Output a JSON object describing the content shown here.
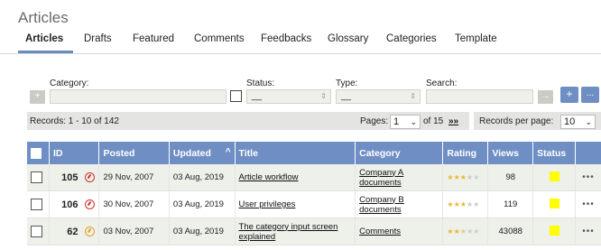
{
  "page": {
    "title": "Articles"
  },
  "tabs": [
    {
      "label": "Articles",
      "active": true
    },
    {
      "label": "Drafts"
    },
    {
      "label": "Featured"
    },
    {
      "label": "Comments"
    },
    {
      "label": "Feedbacks"
    },
    {
      "label": "Glossary"
    },
    {
      "label": "Categories"
    },
    {
      "label": "Template"
    }
  ],
  "filters": {
    "category_label": "Category:",
    "status_label": "Status:",
    "status_value": "__",
    "type_label": "Type:",
    "type_value": "__",
    "search_label": "Search:",
    "add_symbol": "+",
    "go_symbol": "→",
    "add_button": "+",
    "more_button": "..."
  },
  "pager": {
    "records_text": "Records: 1 - 10 of 142",
    "pages_label": "Pages:",
    "current_page": "1",
    "of_text": "of 15",
    "next_symbol": "»»",
    "per_page_label": "Records per page:",
    "per_page_value": "10"
  },
  "table": {
    "headers": {
      "id": "ID",
      "posted": "Posted",
      "updated": "Updated",
      "title": "Title",
      "category": "Category",
      "rating": "Rating",
      "views": "Views",
      "status": "Status"
    },
    "rows": [
      {
        "id": "105",
        "posted": "29 Nov, 2007",
        "updated": "03 Aug, 2019",
        "title_line1": "Article workflow",
        "title_line2": "",
        "category_line1": "Company A",
        "category_line2": "documents",
        "rating": 3,
        "views": "98",
        "icon_color": "#d03030"
      },
      {
        "id": "106",
        "posted": "30 Nov, 2007",
        "updated": "03 Aug, 2019",
        "title_line1": "User privileges",
        "title_line2": "",
        "category_line1": "Company B",
        "category_line2": "documents",
        "rating": 3,
        "views": "119",
        "icon_color": "#d03030"
      },
      {
        "id": "62",
        "posted": "03 Nov, 2007",
        "updated": "03 Aug, 2019",
        "title_line1": "The category input screen",
        "title_line2": "explained",
        "category_line1": "Comments",
        "category_line2": "",
        "rating": 2.5,
        "views": "43088",
        "icon_color": "#e8a020"
      }
    ],
    "more_symbol": "•••",
    "status_color": "#ffff00"
  }
}
